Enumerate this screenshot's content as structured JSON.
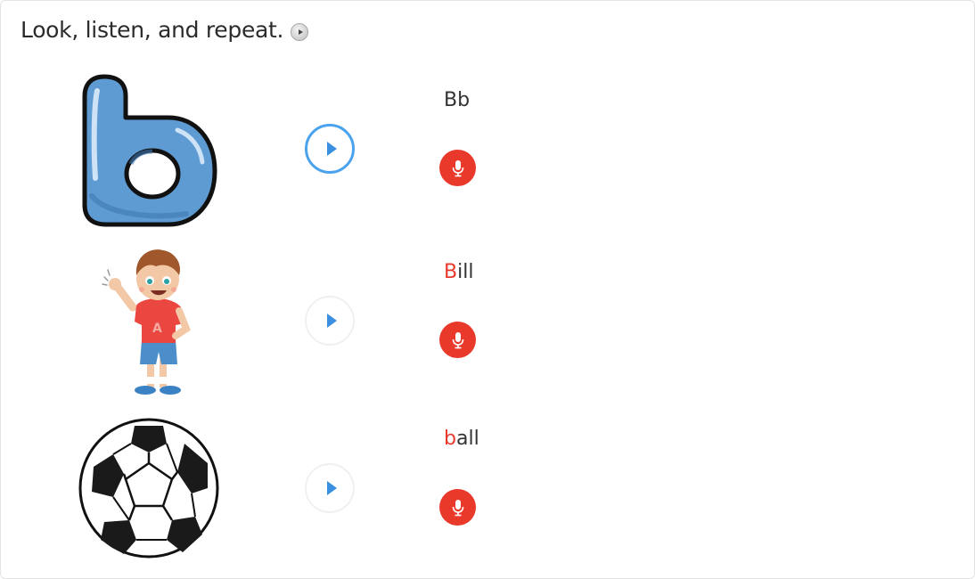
{
  "instruction": {
    "text": "Look, listen, and repeat."
  },
  "items": [
    {
      "word_highlight": "",
      "word_rest": "Bb",
      "image": "letter-b-icon",
      "play_state": "active"
    },
    {
      "word_highlight": "B",
      "word_rest": "ill",
      "image": "boy-bill-icon",
      "play_state": "idle"
    },
    {
      "word_highlight": "b",
      "word_rest": "all",
      "image": "soccer-ball-icon",
      "play_state": "idle"
    }
  ],
  "colors": {
    "highlight": "#e8392c",
    "mic": "#e9392b",
    "play_active_ring": "#4aa3ee",
    "play_arrow": "#3b8fe0",
    "letter_b": "#5f9bd3"
  }
}
